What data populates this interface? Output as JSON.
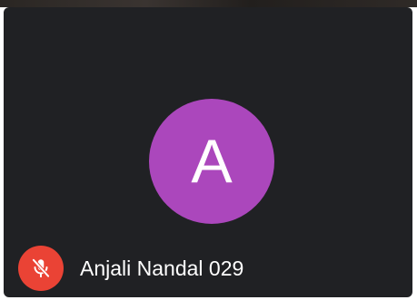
{
  "participant": {
    "initial": "A",
    "name": "Anjali Nandal 029",
    "avatar_color": "#ab47bc",
    "tile_background": "#202124"
  },
  "status": {
    "mic_icon": "mic-off-icon",
    "mic_badge_color": "#ea4335"
  }
}
